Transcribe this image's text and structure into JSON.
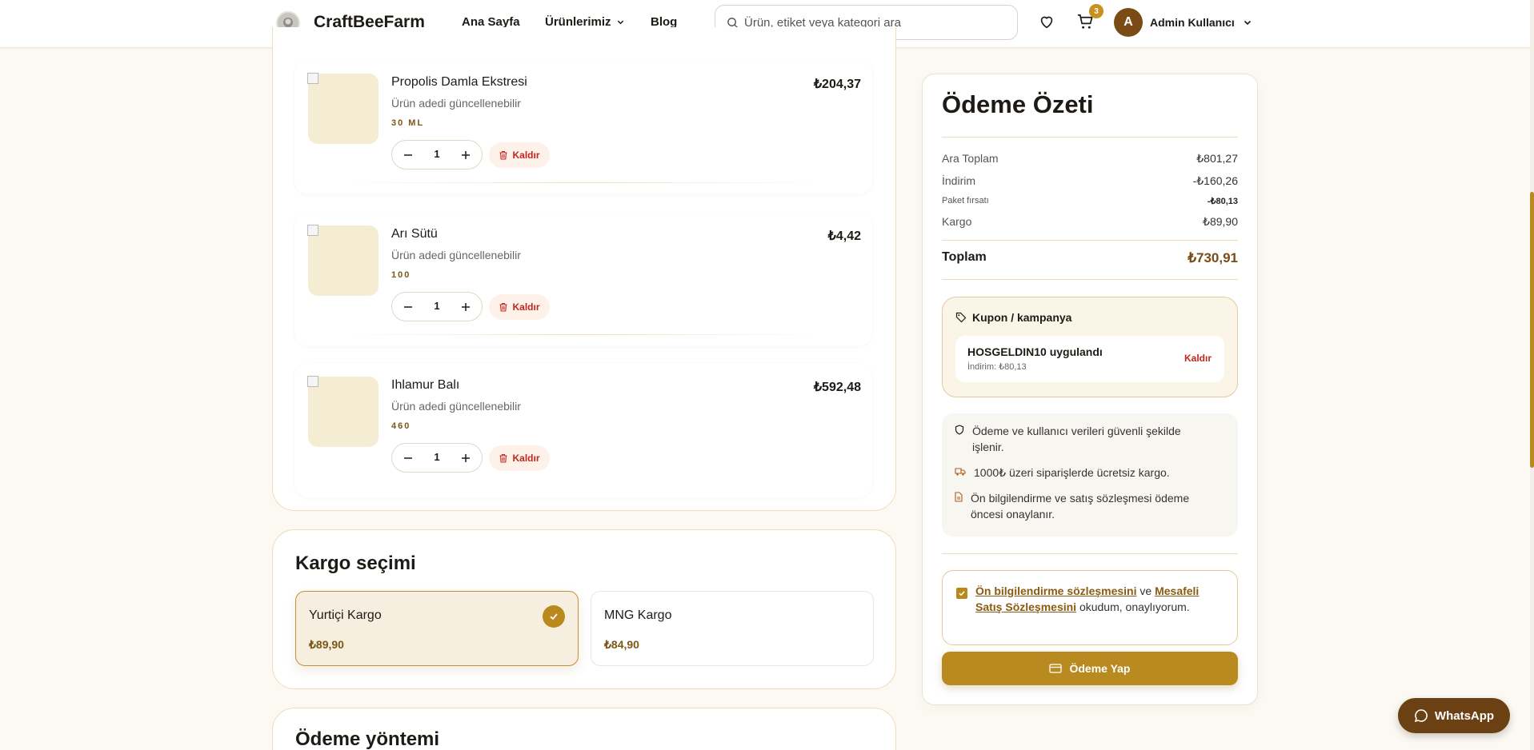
{
  "header": {
    "brand": "CraftBeeFarm",
    "nav": [
      {
        "label": "Ana Sayfa"
      },
      {
        "label": "Ürünlerimiz"
      },
      {
        "label": "Blog"
      }
    ],
    "search": {
      "placeholder": "Ürün, etiket veya kategori ara",
      "value": ""
    },
    "cart_count": "3",
    "user": {
      "initial": "A",
      "name": "Admin Kullanıcı"
    }
  },
  "cart": {
    "items": [
      {
        "name": "Propolis Damla Ekstresi",
        "subtitle": "Ürün adedi güncellenebilir",
        "variant": "30 ML",
        "price": "₺204,37",
        "qty": "1",
        "remove_label": "Kaldır"
      },
      {
        "name": "Arı Sütü",
        "subtitle": "Ürün adedi güncellenebilir",
        "variant": "100",
        "price": "₺4,42",
        "qty": "1",
        "remove_label": "Kaldır"
      },
      {
        "name": "Ihlamur Balı",
        "subtitle": "Ürün adedi güncellenebilir",
        "variant": "460",
        "price": "₺592,48",
        "qty": "1",
        "remove_label": "Kaldır"
      }
    ]
  },
  "shipping": {
    "title": "Kargo seçimi",
    "options": [
      {
        "name": "Yurtiçi Kargo",
        "price": "₺89,90",
        "selected": true
      },
      {
        "name": "MNG Kargo",
        "price": "₺84,90",
        "selected": false
      }
    ]
  },
  "payment_method": {
    "title": "Ödeme yöntemi"
  },
  "summary": {
    "title": "Ödeme Özeti",
    "rows": [
      {
        "label": "Ara Toplam",
        "value": "₺801,27"
      },
      {
        "label": "İndirim",
        "value": "-₺160,26"
      },
      {
        "label": "Paket fırsatı",
        "value": "-₺80,13"
      },
      {
        "label": "Kargo",
        "value": "₺89,90"
      }
    ],
    "total": {
      "label": "Toplam",
      "value": "₺730,91"
    },
    "coupon": {
      "heading": "Kupon / kampanya",
      "applied": "HOSGELDIN10 uygulandı",
      "discount": "İndirim: ₺80,13",
      "remove_label": "Kaldır"
    },
    "info": [
      {
        "text": "Ödeme ve kullanıcı verileri güvenli şekilde işlenir.",
        "icon": "shield-icon"
      },
      {
        "text": "1000₺ üzeri siparişlerde ücretsiz kargo.",
        "icon": "truck-icon"
      },
      {
        "text": "Ön bilgilendirme ve satış sözleşmesi ödeme öncesi onaylanır.",
        "icon": "document-icon"
      }
    ],
    "agreement": {
      "link1": "Ön bilgilendirme sözleşmesini",
      "mid": " ve ",
      "link2": "Mesafeli Satış Sözleşmesini",
      "end": " okudum, onaylıyorum.",
      "checked": true
    },
    "pay_button": "Ödeme Yap"
  },
  "whatsapp": {
    "label": "WhatsApp"
  },
  "colors": {
    "accent": "#b98a1f",
    "brand_dark": "#7a4b15",
    "danger": "#c0271e",
    "panel_border": "#ecdcbc"
  }
}
